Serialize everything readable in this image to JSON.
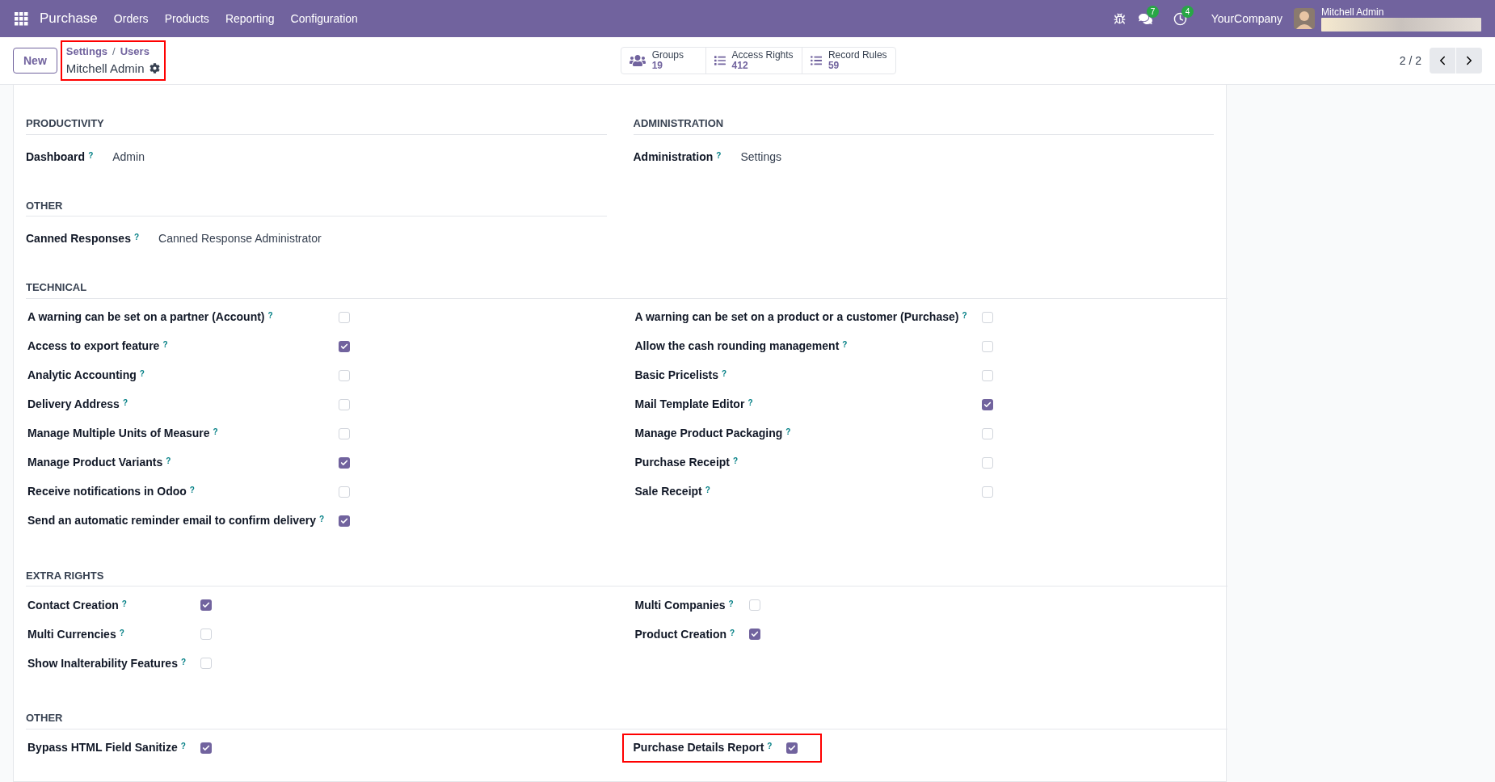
{
  "navbar": {
    "app_name": "Purchase",
    "menu": [
      "Orders",
      "Products",
      "Reporting",
      "Configuration"
    ],
    "chat_badge": "7",
    "activity_badge": "4",
    "company": "YourCompany",
    "user": "Mitchell Admin"
  },
  "control_panel": {
    "new_button": "New",
    "breadcrumbs": [
      "Settings",
      "Users"
    ],
    "separator": "/",
    "record": "Mitchell Admin",
    "highlighted": true,
    "stat_buttons": [
      {
        "kind": "groups",
        "label": "Groups",
        "value": "19"
      },
      {
        "kind": "access",
        "label": "Access Rights",
        "value": "412"
      },
      {
        "kind": "rules",
        "label": "Record Rules",
        "value": "59"
      }
    ],
    "pager": "2 / 2"
  },
  "sections": [
    {
      "kind": "pair",
      "columns": [
        {
          "title": "PRODUCTIVITY",
          "fields": [
            {
              "label": "Dashboard",
              "help": "?",
              "value": "Admin"
            }
          ]
        },
        {
          "title": "ADMINISTRATION",
          "fields": [
            {
              "label": "Administration",
              "help": "?",
              "value": "Settings"
            }
          ]
        }
      ]
    },
    {
      "kind": "pair",
      "columns": [
        {
          "title": "OTHER",
          "fields": [
            {
              "label": "Canned Responses",
              "help": "?",
              "value": "Canned Response Administrator"
            }
          ]
        }
      ]
    },
    {
      "kind": "grid",
      "title": "TECHNICAL",
      "columns": [
        [
          {
            "label": "A warning can be set on a partner (Account)",
            "help": "?",
            "checked": false,
            "highlighted": false
          },
          {
            "label": "Access to export feature",
            "help": "?",
            "checked": true,
            "highlighted": false
          },
          {
            "label": "Analytic Accounting",
            "help": "?",
            "checked": false,
            "highlighted": false
          },
          {
            "label": "Delivery Address",
            "help": "?",
            "checked": false,
            "highlighted": false
          },
          {
            "label": "Manage Multiple Units of Measure",
            "help": "?",
            "checked": false,
            "highlighted": false
          },
          {
            "label": "Manage Product Variants",
            "help": "?",
            "checked": true,
            "highlighted": false
          },
          {
            "label": "Receive notifications in Odoo",
            "help": "?",
            "checked": false,
            "highlighted": false
          },
          {
            "label": "Send an automatic reminder email to confirm delivery",
            "help": "?",
            "checked": true,
            "highlighted": false
          }
        ],
        [
          {
            "label": "A warning can be set on a product or a customer (Purchase)",
            "help": "?",
            "checked": false,
            "highlighted": false
          },
          {
            "label": "Allow the cash rounding management",
            "help": "?",
            "checked": false,
            "highlighted": false
          },
          {
            "label": "Basic Pricelists",
            "help": "?",
            "checked": false,
            "highlighted": false
          },
          {
            "label": "Mail Template Editor",
            "help": "?",
            "checked": true,
            "highlighted": false
          },
          {
            "label": "Manage Product Packaging",
            "help": "?",
            "checked": false,
            "highlighted": false
          },
          {
            "label": "Purchase Receipt",
            "help": "?",
            "checked": false,
            "highlighted": false
          },
          {
            "label": "Sale Receipt",
            "help": "?",
            "checked": false,
            "highlighted": false
          }
        ]
      ]
    },
    {
      "kind": "grid",
      "title": "EXTRA RIGHTS",
      "columns": [
        [
          {
            "label": "Contact Creation",
            "help": "?",
            "checked": true,
            "highlighted": false
          },
          {
            "label": "Multi Currencies",
            "help": "?",
            "checked": false,
            "highlighted": false
          },
          {
            "label": "Show Inalterability Features",
            "help": "?",
            "checked": false,
            "highlighted": false
          }
        ],
        [
          {
            "label": "Multi Companies",
            "help": "?",
            "checked": false,
            "highlighted": false
          },
          {
            "label": "Product Creation",
            "help": "?",
            "checked": true,
            "highlighted": false
          }
        ]
      ]
    },
    {
      "kind": "grid",
      "title": "OTHER",
      "columns": [
        [
          {
            "label": "Bypass HTML Field Sanitize",
            "help": "?",
            "checked": true,
            "highlighted": false
          }
        ],
        [
          {
            "label": "Purchase Details Report",
            "help": "?",
            "checked": true,
            "highlighted": true
          }
        ]
      ]
    }
  ]
}
